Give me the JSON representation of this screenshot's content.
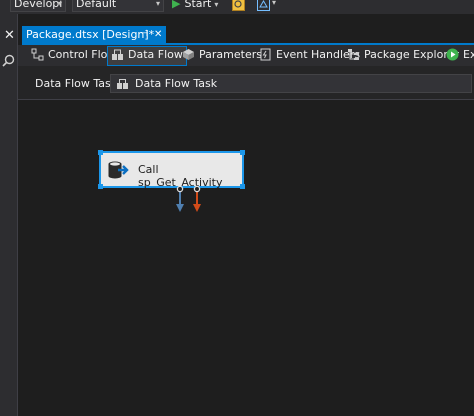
{
  "toolbar": {
    "solution_config": "Developi",
    "platform": "Default",
    "start_label": "Start"
  },
  "document_tab": {
    "title": "Package.dtsx [Design]*",
    "pin_glyph": "⊣",
    "close_glyph": "✕"
  },
  "designer_tabs": [
    {
      "label": "Control Flow",
      "icon": "control-flow-icon"
    },
    {
      "label": "Data Flow",
      "icon": "data-flow-icon",
      "active": true
    },
    {
      "label": "Parameters",
      "icon": "parameters-icon"
    },
    {
      "label": "Event Handlers",
      "icon": "event-handlers-icon"
    },
    {
      "label": "Package Explorer",
      "icon": "package-explorer-icon"
    },
    {
      "label": "Ex",
      "icon": "execute-icon"
    }
  ],
  "task_row": {
    "label": "Data Flow Task:",
    "selected": "Data Flow Task"
  },
  "component": {
    "name": "Call sp_Get_Activity",
    "icon": "stored-procedure-icon"
  },
  "colors": {
    "accent": "#007acc",
    "selection": "#1c97ea",
    "success_path": "#4f7fb0",
    "error_path": "#d14b1a",
    "play_green": "#3fb34f"
  }
}
